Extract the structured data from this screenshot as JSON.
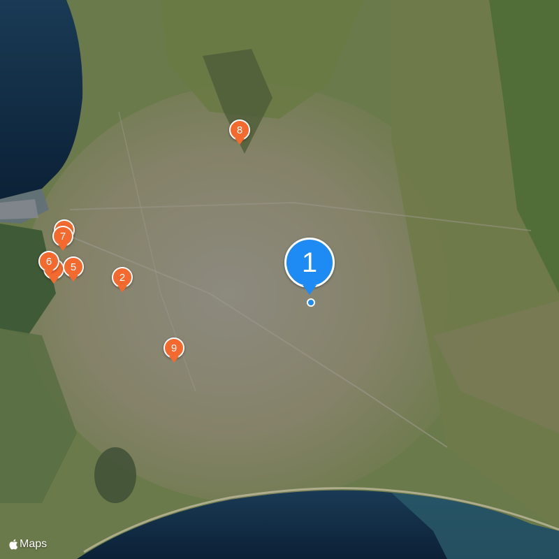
{
  "map": {
    "type": "satellite",
    "attribution": "Maps",
    "colors": {
      "pin_orange": "#f4692e",
      "pin_blue": "#1e8bf5",
      "ocean": "#0f2c45"
    }
  },
  "pins": [
    {
      "label": "1",
      "style": "blue",
      "selected": true
    },
    {
      "label": "2",
      "style": "orange"
    },
    {
      "label": "5",
      "style": "orange"
    },
    {
      "label": "6",
      "style": "orange"
    },
    {
      "label": "7",
      "style": "orange"
    },
    {
      "label": "8",
      "style": "orange"
    },
    {
      "label": "9",
      "style": "orange"
    }
  ]
}
